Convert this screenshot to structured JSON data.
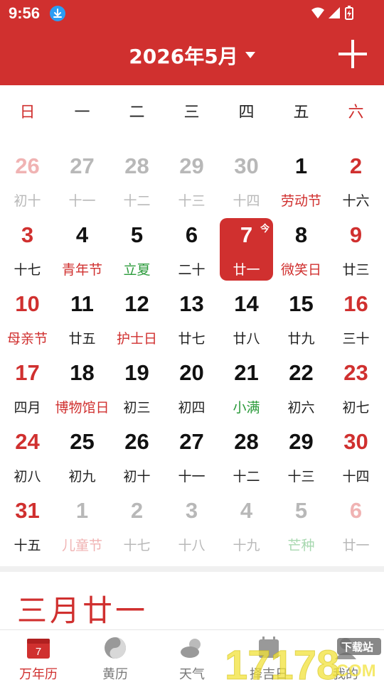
{
  "status_bar": {
    "time": "9:56"
  },
  "header": {
    "title": "2026年5月"
  },
  "weekdays": [
    "日",
    "一",
    "二",
    "三",
    "四",
    "五",
    "六"
  ],
  "weeks": [
    [
      {
        "day": "26",
        "lunar": "初十",
        "other": true
      },
      {
        "day": "27",
        "lunar": "十一",
        "other": true
      },
      {
        "day": "28",
        "lunar": "十二",
        "other": true
      },
      {
        "day": "29",
        "lunar": "十三",
        "other": true
      },
      {
        "day": "30",
        "lunar": "十四",
        "other": true
      },
      {
        "day": "1",
        "lunar": "劳动节",
        "kind": "holiday"
      },
      {
        "day": "2",
        "lunar": "十六"
      }
    ],
    [
      {
        "day": "3",
        "lunar": "十七"
      },
      {
        "day": "4",
        "lunar": "青年节",
        "kind": "holiday"
      },
      {
        "day": "5",
        "lunar": "立夏",
        "kind": "term"
      },
      {
        "day": "6",
        "lunar": "二十"
      },
      {
        "day": "7",
        "lunar": "廿一",
        "today": true
      },
      {
        "day": "8",
        "lunar": "微笑日",
        "kind": "holiday"
      },
      {
        "day": "9",
        "lunar": "廿三"
      }
    ],
    [
      {
        "day": "10",
        "lunar": "母亲节",
        "kind": "holiday"
      },
      {
        "day": "11",
        "lunar": "廿五"
      },
      {
        "day": "12",
        "lunar": "护士日",
        "kind": "holiday"
      },
      {
        "day": "13",
        "lunar": "廿七"
      },
      {
        "day": "14",
        "lunar": "廿八"
      },
      {
        "day": "15",
        "lunar": "廿九"
      },
      {
        "day": "16",
        "lunar": "三十"
      }
    ],
    [
      {
        "day": "17",
        "lunar": "四月"
      },
      {
        "day": "18",
        "lunar": "博物馆日",
        "kind": "holiday"
      },
      {
        "day": "19",
        "lunar": "初三"
      },
      {
        "day": "20",
        "lunar": "初四"
      },
      {
        "day": "21",
        "lunar": "小满",
        "kind": "term"
      },
      {
        "day": "22",
        "lunar": "初六"
      },
      {
        "day": "23",
        "lunar": "初七"
      }
    ],
    [
      {
        "day": "24",
        "lunar": "初八"
      },
      {
        "day": "25",
        "lunar": "初九"
      },
      {
        "day": "26",
        "lunar": "初十"
      },
      {
        "day": "27",
        "lunar": "十一"
      },
      {
        "day": "28",
        "lunar": "十二"
      },
      {
        "day": "29",
        "lunar": "十三"
      },
      {
        "day": "30",
        "lunar": "十四"
      }
    ],
    [
      {
        "day": "31",
        "lunar": "十五"
      },
      {
        "day": "1",
        "lunar": "儿童节",
        "other": true,
        "kind": "holiday"
      },
      {
        "day": "2",
        "lunar": "十七",
        "other": true
      },
      {
        "day": "3",
        "lunar": "十八",
        "other": true
      },
      {
        "day": "4",
        "lunar": "十九",
        "other": true
      },
      {
        "day": "5",
        "lunar": "芒种",
        "other": true,
        "kind": "term"
      },
      {
        "day": "6",
        "lunar": "廿一",
        "other": true
      }
    ]
  ],
  "today_badge": "今",
  "selected_lunar_date": "三月廿一",
  "bottom_nav": [
    {
      "label": "万年历",
      "icon": "calendar-icon",
      "active": true,
      "icon_text": "7"
    },
    {
      "label": "黄历",
      "icon": "yin-yang-icon"
    },
    {
      "label": "天气",
      "icon": "weather-icon"
    },
    {
      "label": "择吉日",
      "icon": "lucky-day-icon"
    },
    {
      "label": "我的",
      "icon": "profile-icon"
    }
  ],
  "watermark": {
    "text": "17178.COM",
    "tag": "下载站"
  },
  "colors": {
    "primary": "#d0302f",
    "term": "#2a9a3a",
    "muted": "#b8b8b8"
  }
}
